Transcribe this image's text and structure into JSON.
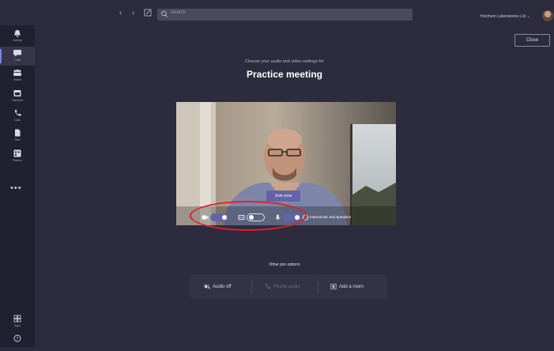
{
  "topbar": {
    "back_icon": "chevron-left-icon",
    "forward_icon": "chevron-right-icon",
    "compose_icon": "compose-icon",
    "search_placeholder": "Search",
    "org_name": "Hoichem Laboratories Ltd"
  },
  "rail": {
    "items": [
      {
        "label": "Activity",
        "icon": "bell-icon"
      },
      {
        "label": "Chat",
        "icon": "chat-icon",
        "active": true
      },
      {
        "label": "Teams",
        "icon": "teams-icon"
      },
      {
        "label": "Calendar",
        "icon": "calendar-icon"
      },
      {
        "label": "Calls",
        "icon": "phone-icon"
      },
      {
        "label": "Files",
        "icon": "file-icon"
      },
      {
        "label": "Planner",
        "icon": "planner-icon"
      }
    ],
    "more": "•••",
    "bottom": [
      {
        "label": "Apps",
        "icon": "apps-icon"
      },
      {
        "label": "",
        "icon": "help-icon"
      }
    ]
  },
  "dialog": {
    "close_label": "Close",
    "subtitle": "Choose your audio and video settings for",
    "title": "Practice meeting",
    "join_label": "Join now",
    "controls": {
      "camera_on": true,
      "blur_on": false,
      "mic_on": true,
      "device_label": "Internal Mic and Speakers"
    },
    "other_join_title": "Other join options",
    "other_options": [
      {
        "label": "Audio off",
        "icon": "speaker-off-icon",
        "enabled": true
      },
      {
        "label": "Phone audio",
        "icon": "phone-icon",
        "enabled": false
      },
      {
        "label": "Add a room",
        "icon": "room-icon",
        "enabled": true
      }
    ]
  },
  "colors": {
    "accent": "#6264a7",
    "background": "#2d2c3e",
    "rail": "#212030",
    "highlight": "#e0202a"
  }
}
